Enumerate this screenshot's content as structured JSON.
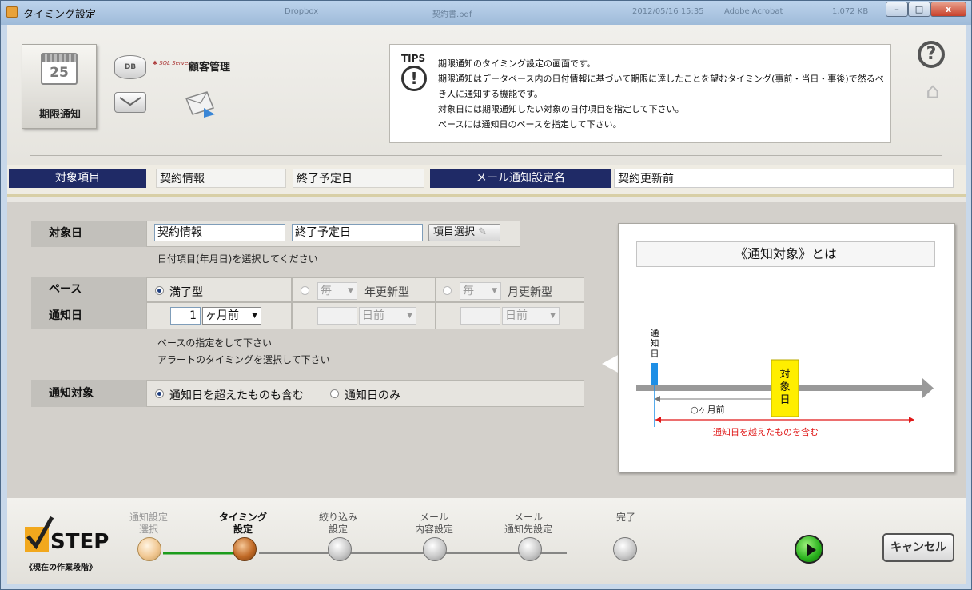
{
  "window": {
    "title": "タイミング設定",
    "taskbar_ghost": [
      "Dropbox",
      "契約書.pdf",
      "2012/05/16 15:35",
      "Adobe Acrobat",
      "1,072 KB"
    ],
    "min_label": "–",
    "max_label": "□",
    "close_label": "x"
  },
  "header": {
    "calendar_day": "25",
    "big_icon_label": "期限通知",
    "db_label": "DB",
    "sql_logo": "SQL Server",
    "customer_mgmt": "顧客管理"
  },
  "tips": {
    "label": "TIPS",
    "lines": [
      "期限通知のタイミング設定の画面です。",
      "期限通知はデータベース内の日付情報に基づいて期限に達したことを望むタイミング(事前・当日・事後)で然るべき人に通知する機能です。",
      "対象日には期限通知したい対象の日付項目を指定して下さい。",
      "ペースには通知日のペースを指定して下さい。"
    ]
  },
  "infobar": {
    "target_label": "対象項目",
    "target_table": "契約情報",
    "target_field": "終了予定日",
    "mail_setting_label": "メール通知設定名",
    "mail_setting_value": "契約更新前"
  },
  "form": {
    "target_date_label": "対象日",
    "target_table": "契約情報",
    "target_field": "終了予定日",
    "pick_button": "項目選択",
    "target_hint": "日付項目(年月日)を選択してください",
    "pace_label": "ペース",
    "pace_options": {
      "full": "満了型",
      "yearly_prefix": "毎",
      "yearly": "年更新型",
      "monthly_prefix": "毎",
      "monthly": "月更新型"
    },
    "notify_date_label": "通知日",
    "notify_value": "1",
    "notify_unit": "ヶ月前",
    "yearly_unit": "日前",
    "monthly_unit": "日前",
    "pace_hint_1": "ペースの指定をして下さい",
    "pace_hint_2": "アラートのタイミングを選択して下さい",
    "notify_target_label": "通知対象",
    "notify_target_options": {
      "include_past": "通知日を超えたものも含む",
      "only": "通知日のみ"
    }
  },
  "explain": {
    "title": "《通知対象》とは",
    "notify_day": "通知日",
    "target_day": "対象日",
    "months_before": "○ヶ月前",
    "include_past": "通知日を越えたものを含む",
    "colors": {
      "timeline": "#999999",
      "marker": "#1e8fe6",
      "target_box": "#ffee00",
      "range": "#e01818"
    }
  },
  "steps": {
    "title": "STEP",
    "subtitle": "《現在の作業段階》",
    "items": [
      {
        "line1": "通知設定",
        "line2": "選択",
        "state": "done"
      },
      {
        "line1": "タイミング",
        "line2": "設定",
        "state": "current"
      },
      {
        "line1": "絞り込み",
        "line2": "設定",
        "state": "todo"
      },
      {
        "line1": "メール",
        "line2": "内容設定",
        "state": "todo"
      },
      {
        "line1": "メール",
        "line2": "通知先設定",
        "state": "todo"
      },
      {
        "line1": "",
        "line2": "完了",
        "state": "todo"
      }
    ],
    "cancel": "キャンセル"
  }
}
